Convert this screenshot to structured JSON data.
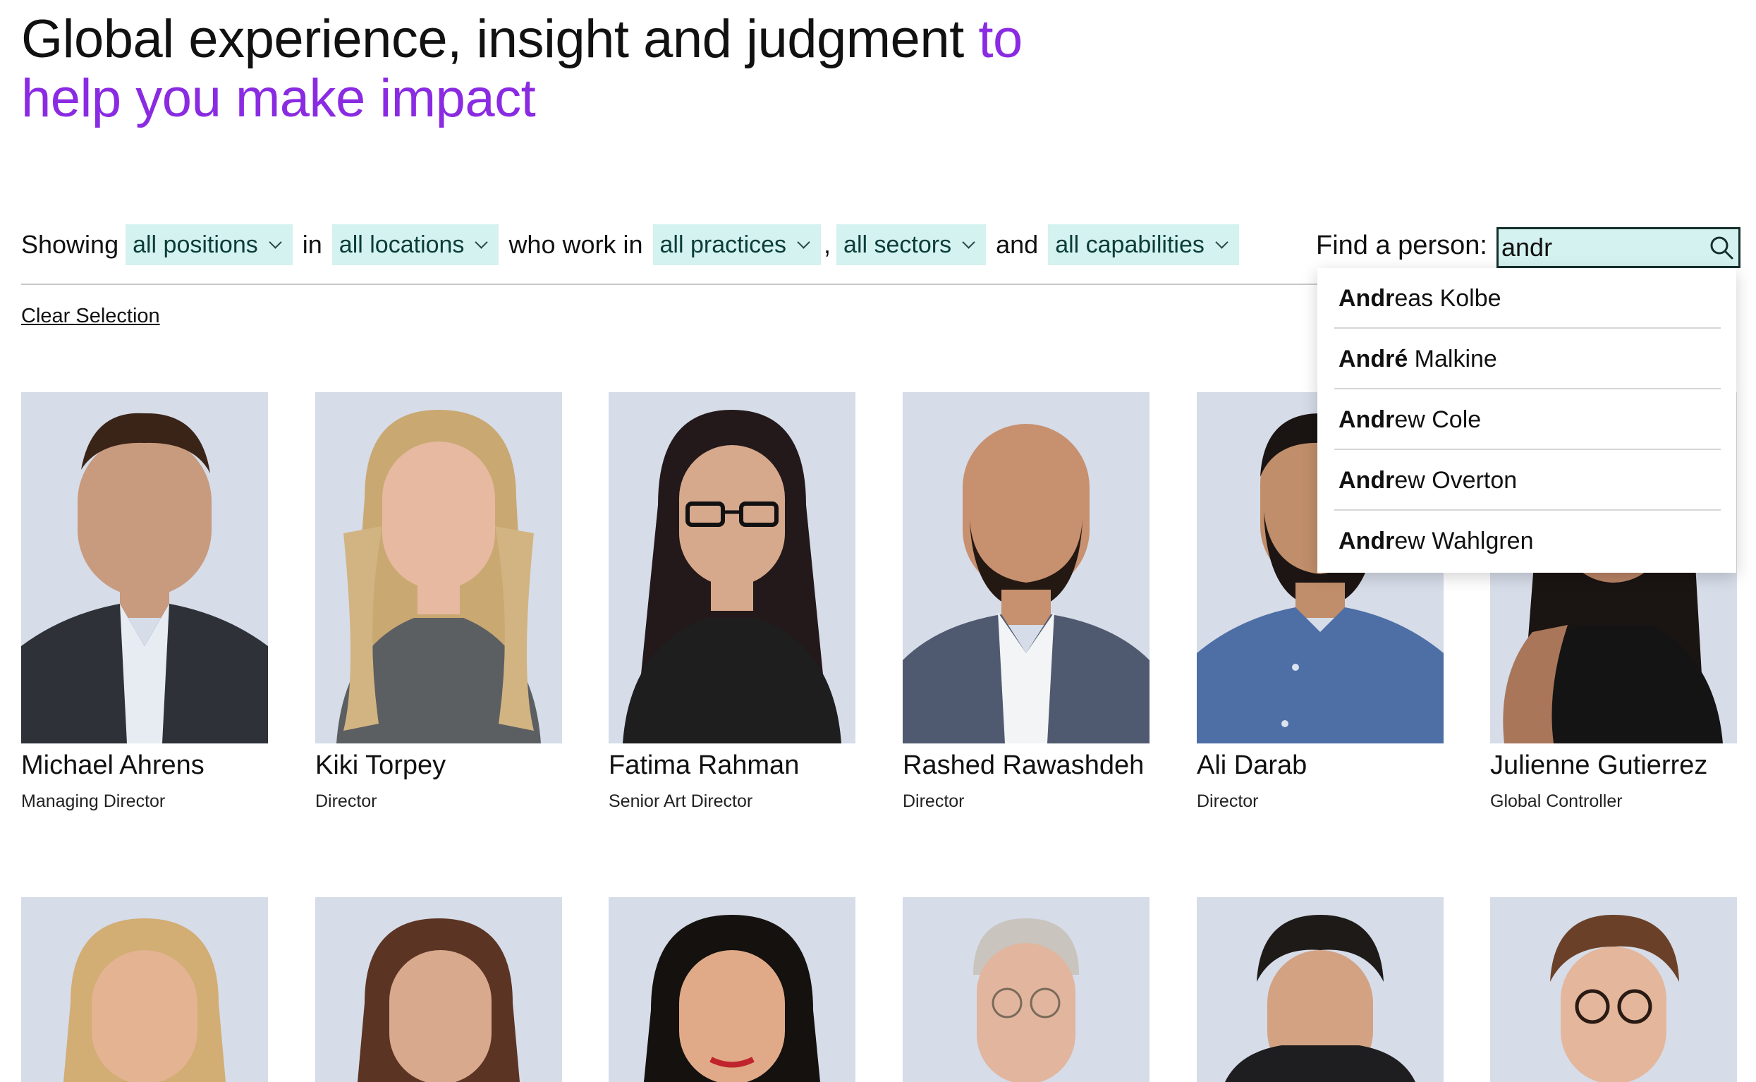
{
  "headline": {
    "text": "Global experience, insight and judgment",
    "accent_text": "to help you make impact",
    "accent_color": "#8a2be2"
  },
  "filters": {
    "showing_label": "Showing",
    "in_label": "in",
    "who_work_in_label": "who work in",
    "comma": ",",
    "and_label": "and",
    "positions": "all positions",
    "locations": "all locations",
    "practices": "all practices",
    "sectors": "all sectors",
    "capabilities": "all capabilities",
    "chip_color": "#d4f2ef"
  },
  "search": {
    "label": "Find a person:",
    "value": "andr",
    "icon": "search-icon"
  },
  "clear_selection": "Clear Selection",
  "suggestions": [
    {
      "match": "Andr",
      "rest": "eas Kolbe"
    },
    {
      "match": "André",
      "rest": " Malkine"
    },
    {
      "match": "Andr",
      "rest": "ew Cole"
    },
    {
      "match": "Andr",
      "rest": "ew Overton"
    },
    {
      "match": "Andr",
      "rest": "ew Wahlgren"
    }
  ],
  "people_row1": [
    {
      "name": "Michael Ahrens",
      "role": "Managing Director"
    },
    {
      "name": "Kiki Torpey",
      "role": "Director"
    },
    {
      "name": "Fatima Rahman",
      "role": "Senior Art Director"
    },
    {
      "name": "Rashed Rawashdeh",
      "role": "Director"
    },
    {
      "name": "Ali Darab",
      "role": "Director"
    },
    {
      "name": "Julienne Gutierrez",
      "role": "Global Controller"
    }
  ]
}
